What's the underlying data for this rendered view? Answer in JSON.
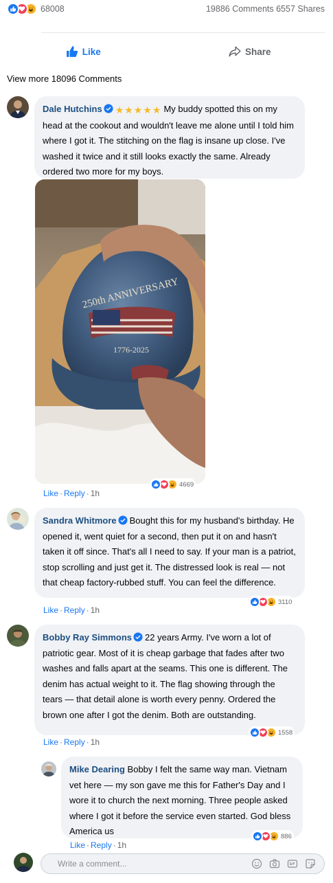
{
  "post_stats": {
    "reaction_count": "68008",
    "comments_shares": "19886 Comments 6557 Shares"
  },
  "actions": {
    "like_label": "Like",
    "share_label": "Share"
  },
  "view_more": "View more 18096 Comments",
  "comments": [
    {
      "author": "Dale Hutchins",
      "stars": "★★★★★",
      "text": "My buddy spotted this on my head at the cookout and wouldn't leave me alone until I told him where I got it. The stitching on the flag is insane up close. I've washed it twice and it still looks exactly the same. Already ordered two more for my boys.",
      "reaction_count": "4669",
      "like": "Like",
      "reply": "Reply",
      "time": "1h"
    },
    {
      "author": "Sandra Whitmore",
      "text": "Bought this for my husband's birthday. He opened it, went quiet for a second, then put it on and hasn't taken it off since. That's all I need to say. If your man is a patriot, stop scrolling and just get it. The distressed look is real — not that cheap factory-rubbed stuff. You can feel the difference.",
      "reaction_count": "3110",
      "like": "Like",
      "reply": "Reply",
      "time": "1h"
    },
    {
      "author": "Bobby Ray Simmons",
      "text": "22 years Army. I've worn a lot of patriotic gear. Most of it is cheap garbage that fades after two washes and falls apart at the seams. This one is different. The denim has actual weight to it. The flag showing through the tears — that detail alone is worth every penny. Ordered the brown one after I got the denim. Both are outstanding.",
      "reaction_count": "1558",
      "like": "Like",
      "reply": "Reply",
      "time": "1h"
    },
    {
      "author": "Mike Dearing",
      "text": "Bobby I felt the same way man. Vietnam vet here — my son gave me this for Father's Day and I wore it to church the next morning. Three people asked where I got it before the service even started. God bless America us",
      "reaction_count": "886",
      "like": "Like",
      "reply": "Reply",
      "time": "1h"
    }
  ],
  "photo": {
    "hat_text_top": "250th ANNIVERSARY",
    "hat_text_bottom": "1776-2025"
  },
  "composer": {
    "placeholder": "Write a comment..."
  },
  "colors": {
    "like_blue": "#1877f2",
    "bubble_bg": "#f0f2f5",
    "author": "#1d4e80",
    "star": "#f7b928"
  }
}
